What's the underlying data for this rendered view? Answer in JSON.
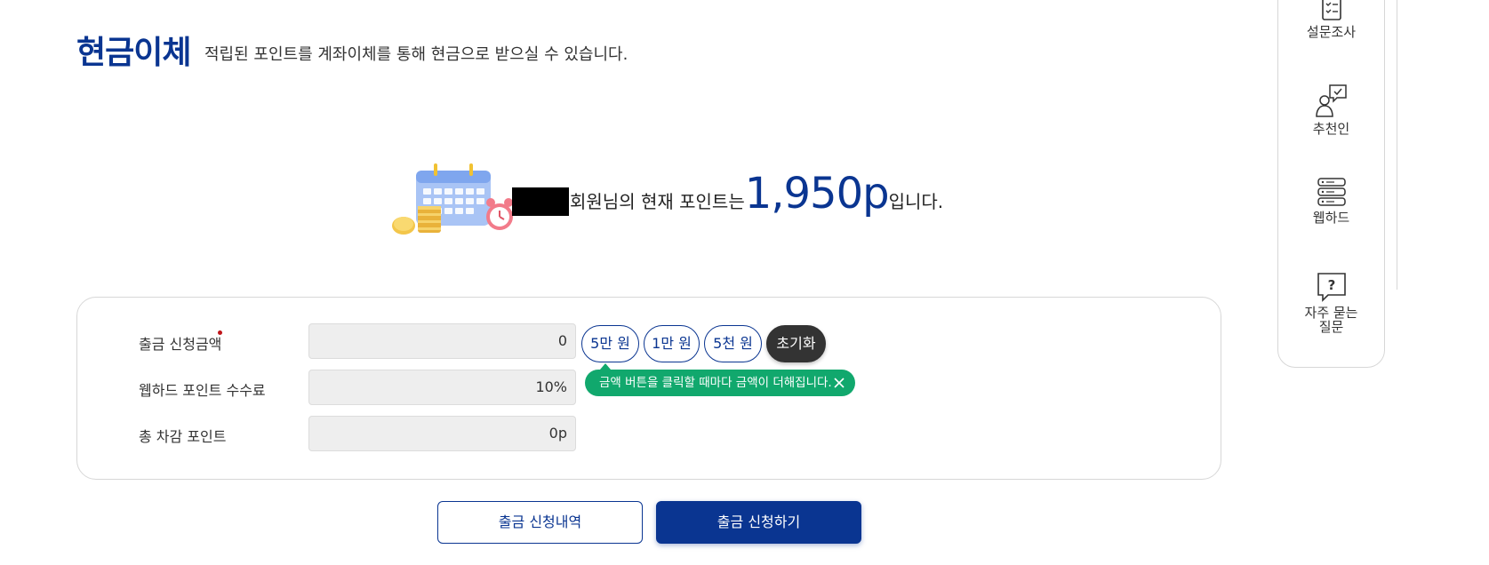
{
  "header": {
    "title": "현금이체",
    "subtitle": "적립된 포인트를 계좌이체를 통해 현금으로 받으실 수 있습니다."
  },
  "summary": {
    "member_suffix": "회원님의 현재 포인트는",
    "points": "1,950p",
    "end": "입니다."
  },
  "form": {
    "rows": [
      {
        "label": "출금 신청금액",
        "value": "0"
      },
      {
        "label": "웹하드 포인트 수수료",
        "value": "10%"
      },
      {
        "label": "총 차감 포인트",
        "value": "0p"
      }
    ],
    "chips": [
      "5만 원",
      "1만 원",
      "5천 원",
      "초기화"
    ],
    "tooltip": "금액 버튼을 클릭할 때마다 금액이 더해집니다."
  },
  "actions": {
    "history": "출금 신청내역",
    "submit": "출금 신청하기"
  },
  "quick_menu": [
    {
      "label": "설문조사",
      "icon": "survey-icon"
    },
    {
      "label": "추천인",
      "icon": "referral-icon"
    },
    {
      "label": "웹하드",
      "icon": "webhard-icon"
    },
    {
      "label": "자주 묻는 질문",
      "icon": "faq-icon"
    }
  ]
}
